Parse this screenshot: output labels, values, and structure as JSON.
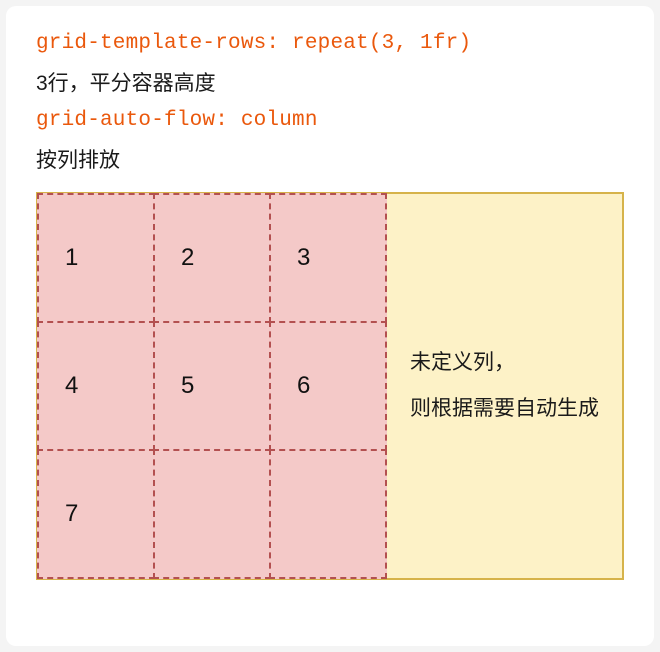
{
  "header": {
    "code1": "grid-template-rows: repeat(3, 1fr)",
    "desc1": "3行，平分容器高度",
    "code2": "grid-auto-flow: column",
    "desc2": "按列排放"
  },
  "grid": {
    "rows": 3,
    "cols": 3,
    "cells": [
      "1",
      "4",
      "7",
      "2",
      "5",
      "",
      "3",
      "6",
      ""
    ]
  },
  "side": {
    "line1": "未定义列，",
    "line2": "则根据需要自动生成"
  },
  "chart_data": {
    "type": "table",
    "title": "CSS grid layout illustration: grid-template-rows: repeat(3,1fr) + grid-auto-flow: column",
    "layout": {
      "columns_shown": 3,
      "rows_shown": 3,
      "flow": "column",
      "items": [
        {
          "n": 1,
          "row": 1,
          "col": 1
        },
        {
          "n": 2,
          "row": 2,
          "col": 1
        },
        {
          "n": 3,
          "row": 3,
          "col": 1
        },
        {
          "n": 4,
          "row": 1,
          "col": 2
        },
        {
          "n": 5,
          "row": 2,
          "col": 2
        },
        {
          "n": 6,
          "row": 3,
          "col": 2
        },
        {
          "n": 7,
          "row": 1,
          "col": 3
        }
      ]
    },
    "note": "未定义列，则根据需要自动生成 (columns not defined — auto generated as needed)"
  }
}
